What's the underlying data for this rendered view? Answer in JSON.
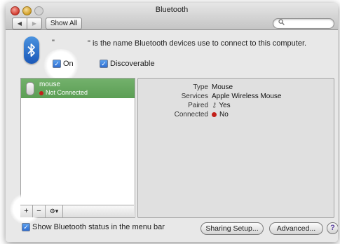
{
  "window": {
    "title": "Bluetooth"
  },
  "toolbar": {
    "back_glyph": "◀",
    "forward_glyph": "▶",
    "show_all_label": "Show All",
    "search_icon": "search-icon"
  },
  "header": {
    "quote_open": "\"",
    "description": "\" is the name Bluetooth devices use to connect to this computer.",
    "on_label": "On",
    "discoverable_label": "Discoverable"
  },
  "devices": [
    {
      "name": "mouse",
      "status": "Not Connected"
    }
  ],
  "list_bar": {
    "add_label": "+",
    "remove_label": "−",
    "action_label": "⚙▾"
  },
  "details": [
    {
      "label": "Type",
      "value": "Mouse"
    },
    {
      "label": "Services",
      "value": "Apple Wireless Mouse"
    },
    {
      "label": "Paired",
      "value": "Yes"
    },
    {
      "label": "Connected",
      "value": "No"
    }
  ],
  "footer": {
    "show_status_label": "Show Bluetooth status in the menu bar",
    "sharing_setup_label": "Sharing Setup...",
    "advanced_label": "Advanced...",
    "help_label": "?"
  },
  "colors": {
    "selection": "#5b9e54",
    "accent": "#2f6ed0",
    "disconnected": "#c2201a"
  }
}
